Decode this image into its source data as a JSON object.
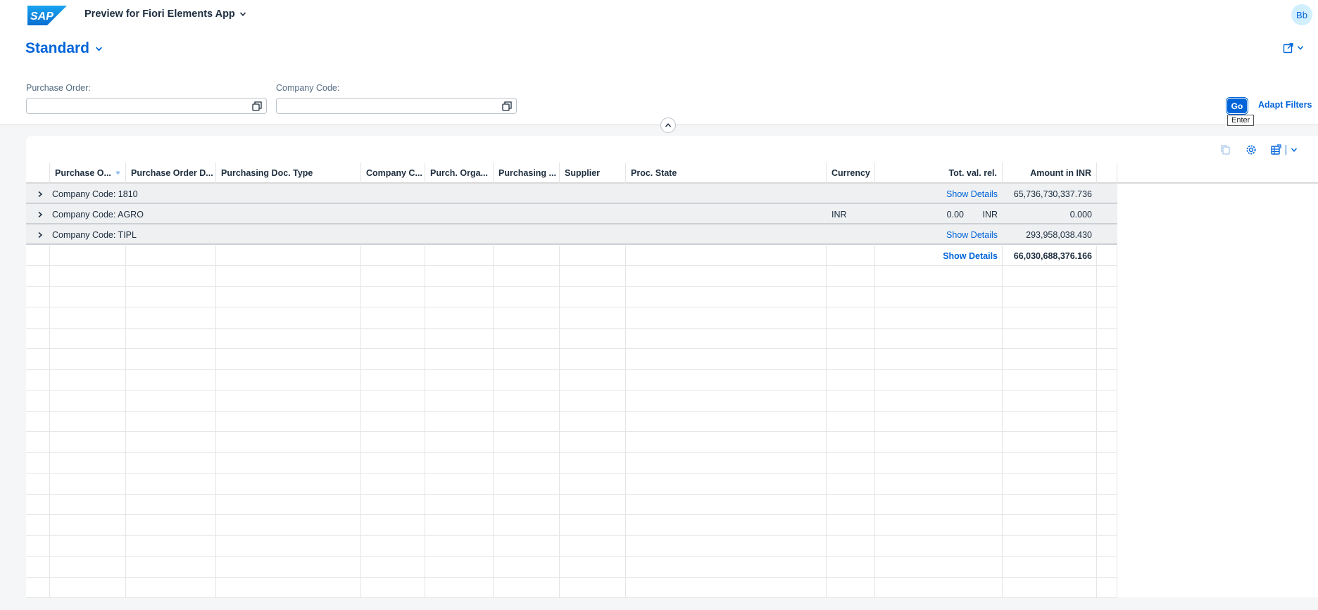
{
  "shell": {
    "logo_text": "SAP",
    "app_title": "Preview for Fiori Elements App",
    "avatar_initials": "Bb"
  },
  "header": {
    "variant_name": "Standard"
  },
  "filters": [
    {
      "label": "Purchase Order:",
      "value": ""
    },
    {
      "label": "Company Code:",
      "value": ""
    }
  ],
  "actions": {
    "go_label": "Go",
    "go_tooltip": "Enter",
    "adapt_filters_label": "Adapt Filters"
  },
  "table": {
    "columns": [
      "Purchase O...",
      "Purchase Order D...",
      "Purchasing Doc. Type",
      "Company C...",
      "Purch. Orga...",
      "Purchasing ...",
      "Supplier",
      "Proc. State",
      "Currency",
      "Tot. val. rel.",
      "Amount in INR"
    ],
    "groups": [
      {
        "label": "Company Code: 1810",
        "currency": "",
        "tot_val": "",
        "tot_val_currency": "",
        "tot_val_link": "Show Details",
        "amount": "65,736,730,337.736"
      },
      {
        "label": "Company Code: AGRO",
        "currency": "INR",
        "tot_val": "0.00",
        "tot_val_currency": "INR",
        "tot_val_link": "",
        "amount": "0.000"
      },
      {
        "label": "Company Code: TIPL",
        "currency": "",
        "tot_val": "",
        "tot_val_currency": "",
        "tot_val_link": "Show Details",
        "amount": "293,958,038.430"
      }
    ],
    "total": {
      "tot_val_link": "Show Details",
      "amount": "66,030,688,376.166"
    }
  },
  "colors": {
    "accent": "#0064d9",
    "group_row_bg": "#eef0f2",
    "page_bg": "#f5f6f7"
  }
}
